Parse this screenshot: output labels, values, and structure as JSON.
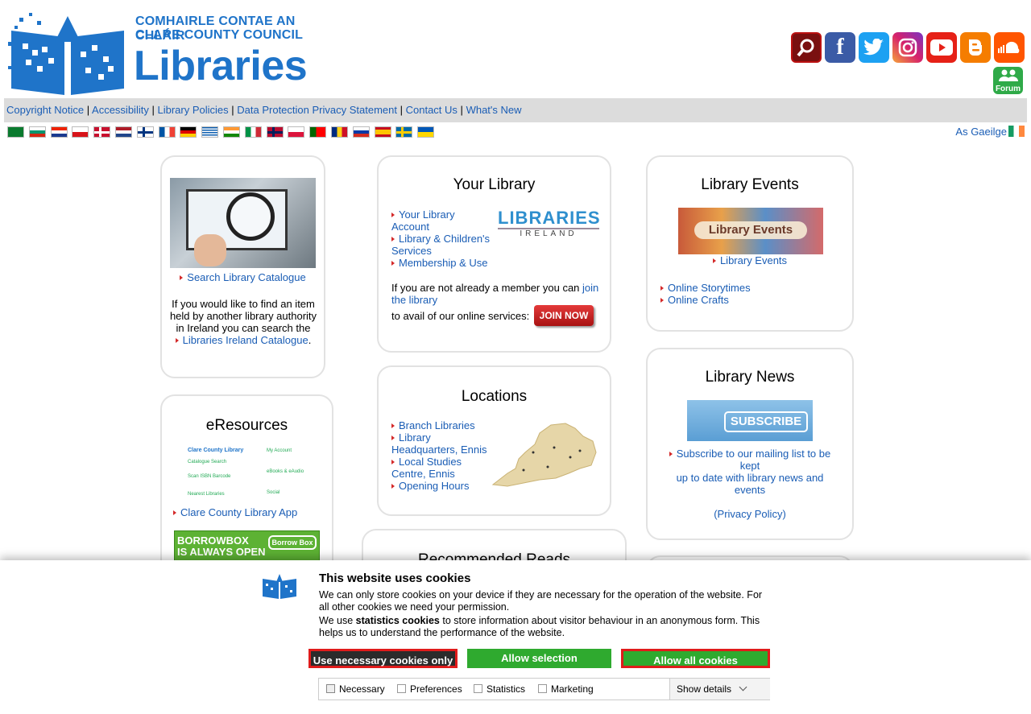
{
  "header": {
    "logo_line1": "COMHAIRLE CONTAE AN CHLÁIR",
    "logo_line2": "CLARE COUNTY COUNCIL",
    "logo_line3": "Libraries",
    "forum_label": "Forum"
  },
  "social_icons": [
    "search-icon",
    "facebook-icon",
    "twitter-icon",
    "instagram-icon",
    "youtube-icon",
    "blogger-icon",
    "soundcloud-icon"
  ],
  "topnav": {
    "links": [
      "Copyright Notice",
      "Accessibility",
      "Library Policies",
      "Data Protection Privacy Statement",
      "Contact Us",
      "What's New"
    ],
    "separator": "|"
  },
  "language_flags": [
    "arabic",
    "bulgarian",
    "croatian",
    "czech",
    "danish",
    "dutch",
    "finnish",
    "french",
    "german",
    "greek",
    "hindi",
    "italian",
    "norwegian",
    "polish",
    "portuguese",
    "romanian",
    "russian",
    "spanish",
    "swedish",
    "ukrainian"
  ],
  "gaeilge_label": "As Gaeilge",
  "search_box": {
    "link": "Search Library Catalogue",
    "text": "If you would like to find an item held by another library authority in Ireland you can search the",
    "link2": "Libraries Ireland Catalogue",
    "period": "."
  },
  "eresources": {
    "title": "eResources",
    "app_link": "Clare County Library App",
    "app_items": [
      "Clare County Library",
      "Catalogue Search",
      "Scan ISBN Barcode",
      "Nearest Libraries",
      "My Account",
      "eBooks & eAudio",
      "Social"
    ],
    "borrowbox_line1": "BORROWBOX",
    "borrowbox_line2": "IS ALWAYS OPEN",
    "borrowbox_logo": "Borrow Box"
  },
  "your_library": {
    "title": "Your Library",
    "links": [
      "Your Library Account",
      "Library & Children's Services",
      "Membership & Use"
    ],
    "logo_top": "LIBRARIES",
    "logo_bottom": "IRELAND",
    "member_text": "If you are not already a member you can",
    "join_link": "join the library",
    "avail_text": "to avail of our online services:",
    "join_button": "JOIN NOW"
  },
  "locations": {
    "title": "Locations",
    "links": [
      "Branch Libraries",
      "Library Headquarters, Ennis",
      "Local Studies Centre, Ennis",
      "Opening Hours"
    ]
  },
  "recommended": {
    "title": "Recommended Reads"
  },
  "events": {
    "title": "Library Events",
    "banner": "Library Events",
    "link": "Library Events",
    "links": [
      "Online Storytimes",
      "Online Crafts"
    ]
  },
  "news": {
    "title": "Library News",
    "banner": "SUBSCRIBE",
    "link": "Subscribe to our mailing list to be kept",
    "text": "up to date with library news and events",
    "privacy": "(Privacy Policy)"
  },
  "cookie": {
    "title": "This website uses cookies",
    "p1": "We can only store cookies on your device if they are necessary for the operation of the website. For all other cookies we need your permission.",
    "p2_pre": "We use",
    "p2_bold": "statistics cookies",
    "p2_post": "to store information about visitor behaviour in an anonymous form. This helps us to understand the performance of the website.",
    "btn_necessary": "Use necessary cookies only",
    "btn_selection": "Allow selection",
    "btn_all": "Allow all cookies",
    "checks": [
      "Necessary",
      "Preferences",
      "Statistics",
      "Marketing"
    ],
    "show_details": "Show details",
    "colors": {
      "green": "#2faa2f",
      "red": "#e01b1b",
      "dark": "#2b2b2b"
    }
  }
}
